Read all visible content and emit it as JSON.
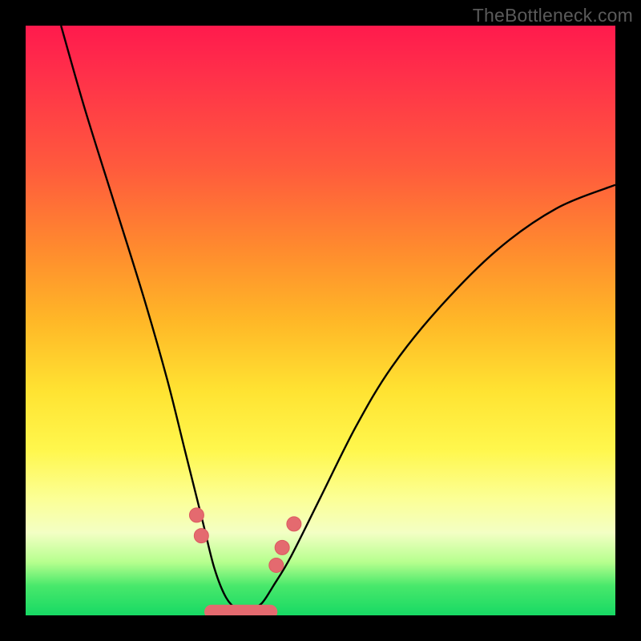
{
  "watermark": "TheBottleneck.com",
  "colors": {
    "background": "#000000",
    "curve_stroke": "#000000",
    "marker_fill": "#e46a6f",
    "marker_stroke": "#dc5a60",
    "gradient_stops": [
      "#ff1a4d",
      "#ff5a3d",
      "#ffb727",
      "#fff74d",
      "#48e86b",
      "#17d964"
    ]
  },
  "chart_data": {
    "type": "line",
    "title": "",
    "xlabel": "",
    "ylabel": "",
    "xlim": [
      0,
      100
    ],
    "ylim": [
      0,
      100
    ],
    "note": "Axes have no visible tick labels; values are read in relative 0–100 units of the plot area. y=0 is the bottom edge (green), y=100 is the top (red).",
    "series": [
      {
        "name": "bottleneck-curve",
        "x": [
          6,
          10,
          15,
          20,
          24,
          27,
          30,
          32,
          34,
          36,
          38,
          40,
          42,
          45,
          50,
          56,
          62,
          70,
          80,
          90,
          100
        ],
        "y": [
          100,
          86,
          70,
          54,
          40,
          28,
          16,
          8,
          3,
          1,
          1,
          2,
          5,
          10,
          20,
          32,
          42,
          52,
          62,
          69,
          73
        ]
      }
    ],
    "markers": {
      "name": "highlighted-points",
      "comment": "Salmon circular markers clustered near the valley and a thick salmon segment at the very bottom",
      "points": [
        {
          "x": 29.0,
          "y": 17.0
        },
        {
          "x": 29.8,
          "y": 13.5
        },
        {
          "x": 42.5,
          "y": 8.5
        },
        {
          "x": 43.5,
          "y": 11.5
        },
        {
          "x": 45.5,
          "y": 15.5
        }
      ],
      "bottom_band": {
        "x_start": 31.5,
        "x_end": 41.5,
        "y": 0.6,
        "thickness_pct": 2.4
      }
    }
  }
}
